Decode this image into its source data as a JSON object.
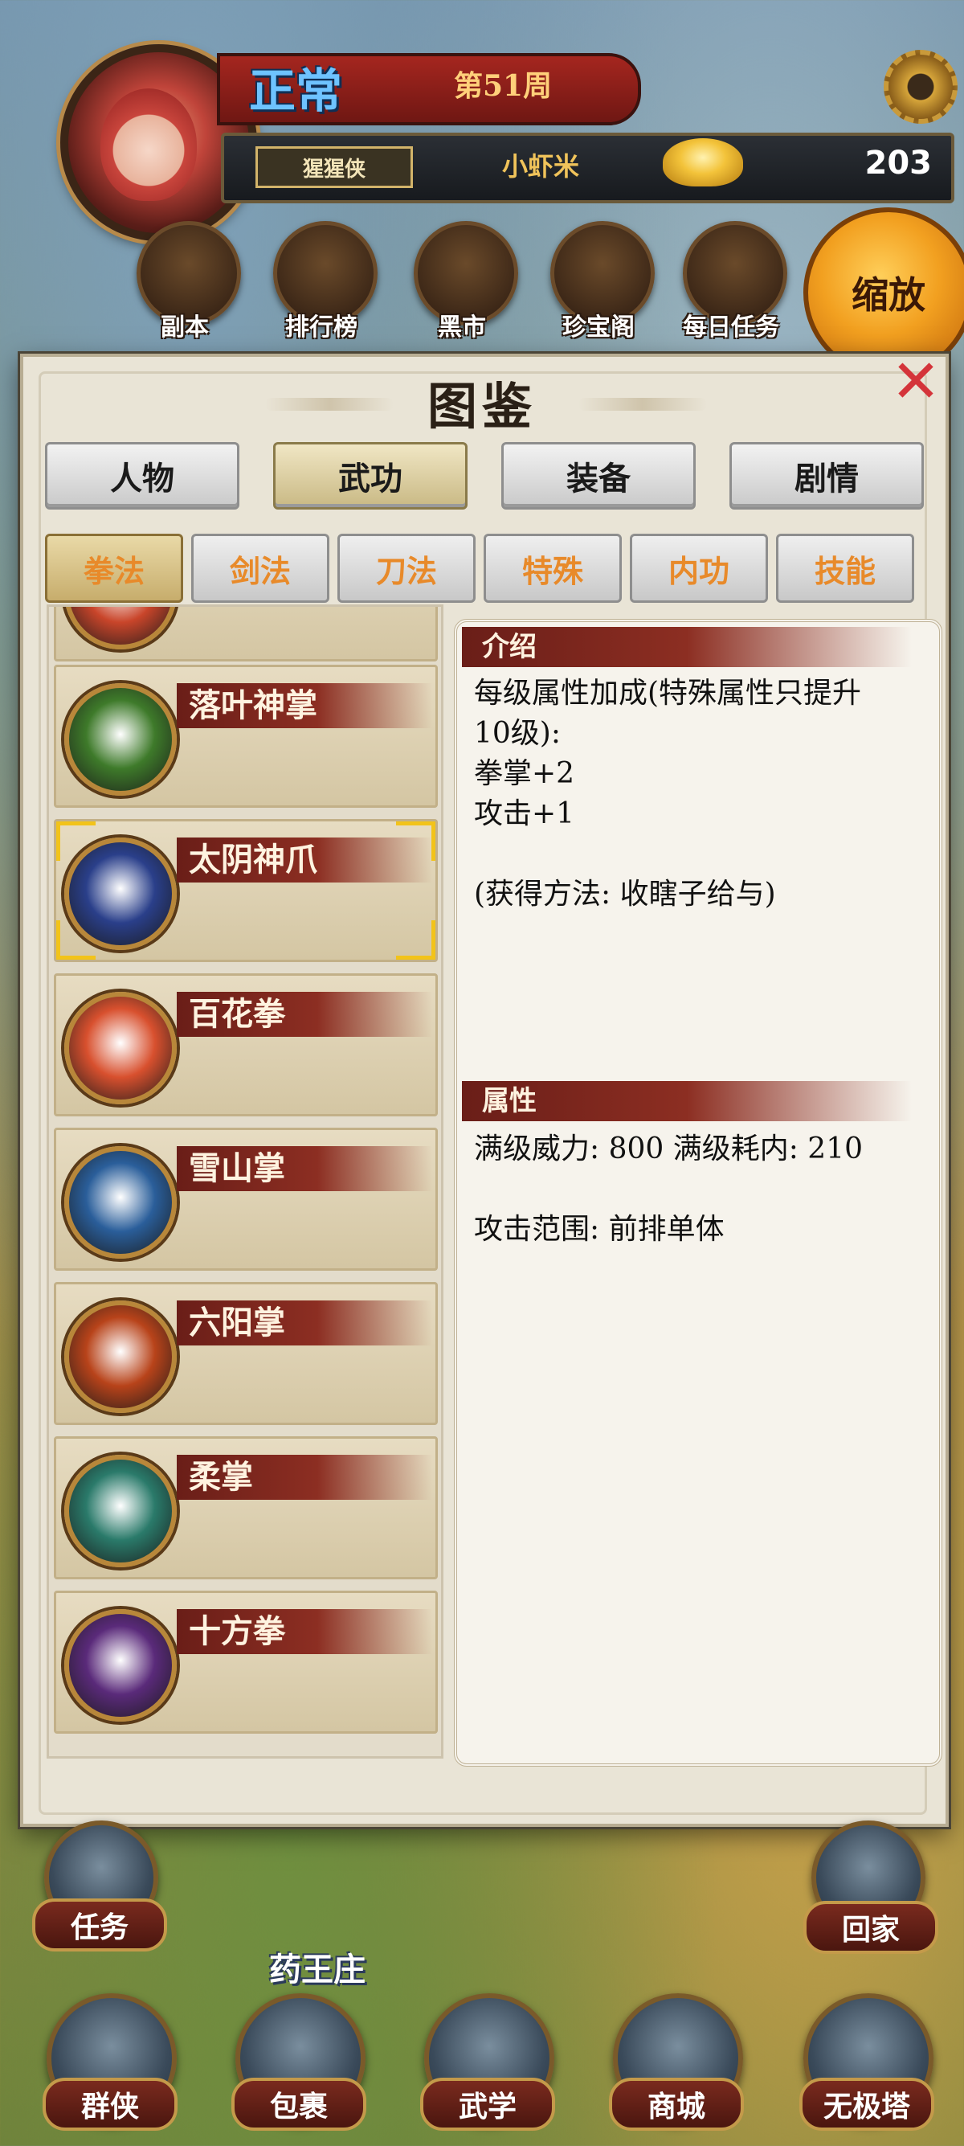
{
  "header": {
    "status": "正常",
    "week": "第51周",
    "rank": "猩猩侠",
    "player_name": "小虾米",
    "gold": "203"
  },
  "top_nav": [
    {
      "label": "副本",
      "icon": "crossed-swords-icon"
    },
    {
      "label": "排行榜",
      "icon": "scroll-icon"
    },
    {
      "label": "黑市",
      "icon": "coin-shop-icon"
    },
    {
      "label": "珍宝阁",
      "icon": "treasure-tree-icon"
    },
    {
      "label": "每日任务",
      "icon": "task-scroll-icon"
    }
  ],
  "zoom_label": "缩放",
  "panel": {
    "title": "图鉴",
    "tabs": [
      "人物",
      "武功",
      "装备",
      "剧情"
    ],
    "active_tab": "武功",
    "subtabs": [
      "拳法",
      "剑法",
      "刀法",
      "特殊",
      "内功",
      "技能"
    ],
    "active_subtab": "拳法",
    "skills": [
      {
        "name": "",
        "color": "#c9452a"
      },
      {
        "name": "落叶神掌",
        "color": "#3e7a2a"
      },
      {
        "name": "太阴神爪",
        "color": "#2a3f8a"
      },
      {
        "name": "百花拳",
        "color": "#d8502e"
      },
      {
        "name": "雪山掌",
        "color": "#2a5e9a"
      },
      {
        "name": "六阳掌",
        "color": "#b8431a"
      },
      {
        "name": "柔掌",
        "color": "#2a7a6a"
      },
      {
        "name": "十方拳",
        "color": "#5a2a7a"
      }
    ],
    "selected_skill": "太阴神爪",
    "detail": {
      "intro_title": "介绍",
      "intro_text": "每级属性加成(特殊属性只提升\n10级):\n拳掌+2\n攻击+1\n\n(获得方法: 收瞎子给与)",
      "attr_title": "属性",
      "attr_text": "满级威力: 800 满级耗内: 210\n\n攻击范围: 前排单体"
    }
  },
  "map_labels": [
    "药王庄"
  ],
  "side_buttons": {
    "task": "任务",
    "home": "回家"
  },
  "bottom_nav": [
    "群侠",
    "包裹",
    "武学",
    "商城",
    "无极塔"
  ]
}
